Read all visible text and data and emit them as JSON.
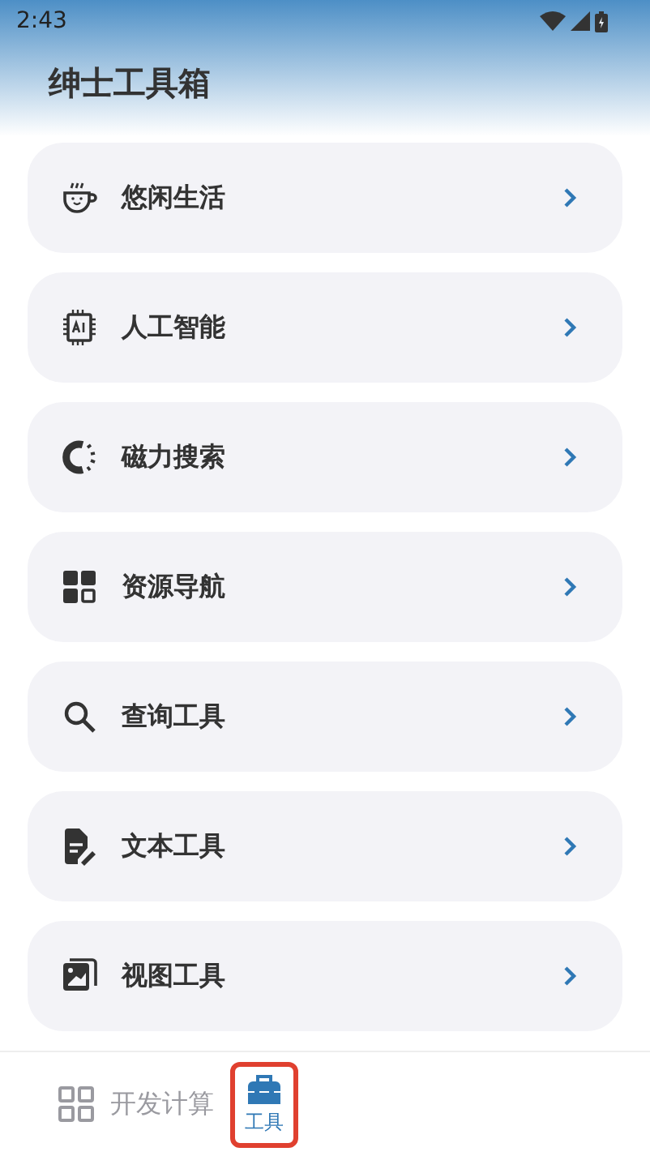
{
  "status_bar": {
    "time": "2:43"
  },
  "app_bar": {
    "title": "绅士工具箱"
  },
  "menu_items": [
    {
      "label": "悠闲生活"
    },
    {
      "label": "人工智能"
    },
    {
      "label": "磁力搜索"
    },
    {
      "label": "资源导航"
    },
    {
      "label": "查询工具"
    },
    {
      "label": "文本工具"
    },
    {
      "label": "视图工具"
    }
  ],
  "bottom_nav": [
    {
      "label": "开发计算",
      "selected": false
    },
    {
      "label": "工具",
      "selected": true
    }
  ]
}
